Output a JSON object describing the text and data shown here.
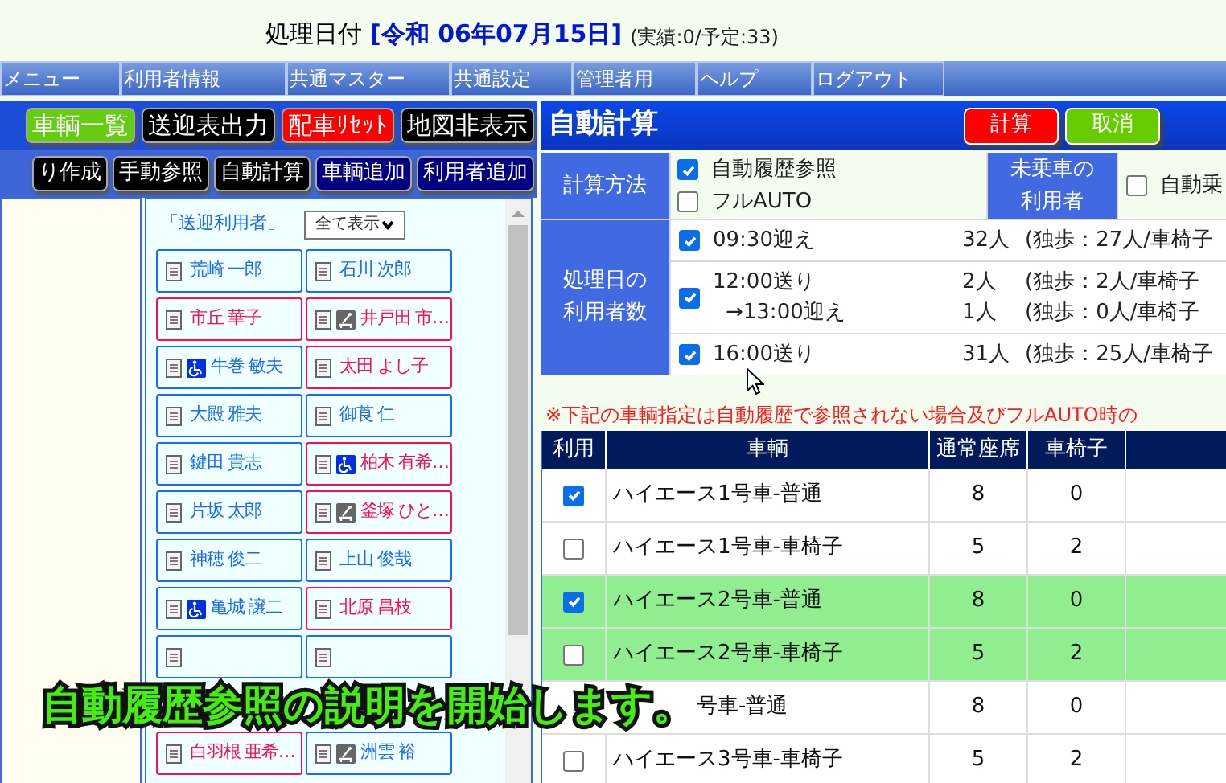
{
  "header": {
    "label": "処理日付",
    "date": "[令和 06年07月15日]",
    "summary": "(実績:0/予定:33)"
  },
  "menu": [
    {
      "label": "メニュー"
    },
    {
      "label": "利用者情報"
    },
    {
      "label": "共通マスター"
    },
    {
      "label": "共通設定"
    },
    {
      "label": "管理者用"
    },
    {
      "label": "ヘルプ"
    },
    {
      "label": "ログアウト"
    }
  ],
  "toolbar_top": [
    {
      "label": "車輌一覧",
      "color": "#66cc11"
    },
    {
      "label": "送迎表出力",
      "color": "#000000"
    },
    {
      "label": "配車ﾘｾｯﾄ",
      "color": "#ff0000"
    },
    {
      "label": "地図非表示",
      "color": "#000000"
    }
  ],
  "toolbar_bottom": [
    {
      "label": "り作成",
      "color": "#000000"
    },
    {
      "label": "手動参照",
      "color": "#000000"
    },
    {
      "label": "自動計算",
      "color": "#000000"
    },
    {
      "label": "車輌追加",
      "color": "#000080"
    },
    {
      "label": "利用者追加",
      "color": "#000080"
    }
  ],
  "users_panel": {
    "title": "「送迎利用者」",
    "filter": "全て表示",
    "users": [
      {
        "name": "荒崎 一郎",
        "color": "#1a6aff",
        "kind": "plain"
      },
      {
        "name": "石川 次郎",
        "color": "#1a6aff",
        "kind": "plain"
      },
      {
        "name": "市丘 華子",
        "color": "#ff0a5a",
        "kind": "plain"
      },
      {
        "name": "井戸田 市…",
        "color": "#ff0a5a",
        "kind": "stretcher"
      },
      {
        "name": "牛巻 敏夫",
        "color": "#1a6aff",
        "kind": "wheelchair"
      },
      {
        "name": "太田 よし子",
        "color": "#ff0a5a",
        "kind": "plain"
      },
      {
        "name": "大殿 雅夫",
        "color": "#1a6aff",
        "kind": "plain"
      },
      {
        "name": "御莨 仁",
        "color": "#1a6aff",
        "kind": "plain"
      },
      {
        "name": "鍵田 貴志",
        "color": "#1a6aff",
        "kind": "plain"
      },
      {
        "name": "柏木 有希…",
        "color": "#ff0a5a",
        "kind": "wheelchair"
      },
      {
        "name": "片坂 太郎",
        "color": "#1a6aff",
        "kind": "plain"
      },
      {
        "name": "釜塚 ひと…",
        "color": "#ff0a5a",
        "kind": "stretcher"
      },
      {
        "name": "神穂 俊二",
        "color": "#1a6aff",
        "kind": "plain"
      },
      {
        "name": "上山 俊哉",
        "color": "#1a6aff",
        "kind": "plain"
      },
      {
        "name": "亀城 譲二",
        "color": "#1a6aff",
        "kind": "wheelchair"
      },
      {
        "name": "北原 昌枝",
        "color": "#ff0a5a",
        "kind": "plain"
      },
      {
        "color": "#1a6aff",
        "kind": "plain"
      },
      {
        "color": "#1a6aff",
        "kind": "plain"
      },
      {
        "kind": "covered"
      },
      {
        "kind": "covered"
      },
      {
        "name": "白羽根 亜希…",
        "color": "#ff0a5a",
        "kind": "plain"
      },
      {
        "name": "洲雲 裕",
        "color": "#1a6aff",
        "kind": "stretcher"
      }
    ]
  },
  "auto_calc": {
    "title": "自動計算",
    "buttons": [
      {
        "label": "計算",
        "color": "#ff0000"
      },
      {
        "label": "取消",
        "color": "#66cc00"
      }
    ],
    "method": {
      "label": "計算方法",
      "options": [
        {
          "label": "自動履歴参照",
          "checked": true
        },
        {
          "label": "フルAUTO",
          "checked": false
        }
      ]
    },
    "unboarded": {
      "label": "未乗車の利用者",
      "option": {
        "label": "自動乗",
        "checked": false
      }
    },
    "counts": {
      "label": "処理日の利用者数",
      "groups": [
        {
          "checked": true,
          "lines": [
            {
              "time": "09:30迎え",
              "count": "32人",
              "detail": "(独歩：27人/車椅子"
            }
          ]
        },
        {
          "checked": true,
          "lines": [
            {
              "time": "12:00送り",
              "count": "2人",
              "detail": "(独歩：2人/車椅子"
            },
            {
              "time": "→13:00迎え",
              "count": "1人",
              "detail": "(独歩：0人/車椅子"
            }
          ]
        },
        {
          "checked": true,
          "lines": [
            {
              "time": "16:00送り",
              "count": "31人",
              "detail": "(独歩：25人/車椅子"
            }
          ]
        }
      ]
    },
    "note": "※下記の車輌指定は自動履歴で参照されない場合及びフルAUTO時の",
    "vehicles": {
      "columns": [
        "利用",
        "車輌",
        "通常座席",
        "車椅子"
      ],
      "rows": [
        {
          "checked": true,
          "selected": false,
          "name": "ハイエース1号車-普通",
          "seats": "8",
          "wheelchairs": "0"
        },
        {
          "checked": false,
          "selected": false,
          "name": "ハイエース1号車-車椅子",
          "seats": "5",
          "wheelchairs": "2"
        },
        {
          "checked": true,
          "selected": true,
          "name": "ハイエース2号車-普通",
          "seats": "8",
          "wheelchairs": "0"
        },
        {
          "checked": false,
          "selected": true,
          "name": "ハイエース2号車-車椅子",
          "seats": "5",
          "wheelchairs": "2"
        },
        {
          "selected": false,
          "name": "号車-普通",
          "seats": "8",
          "wheelchairs": "0"
        },
        {
          "checked": false,
          "selected": false,
          "name": "ハイエース3号車-車椅子",
          "seats": "5",
          "wheelchairs": "2"
        }
      ]
    }
  },
  "caption": "自動履歴参照の説明を開始します。"
}
